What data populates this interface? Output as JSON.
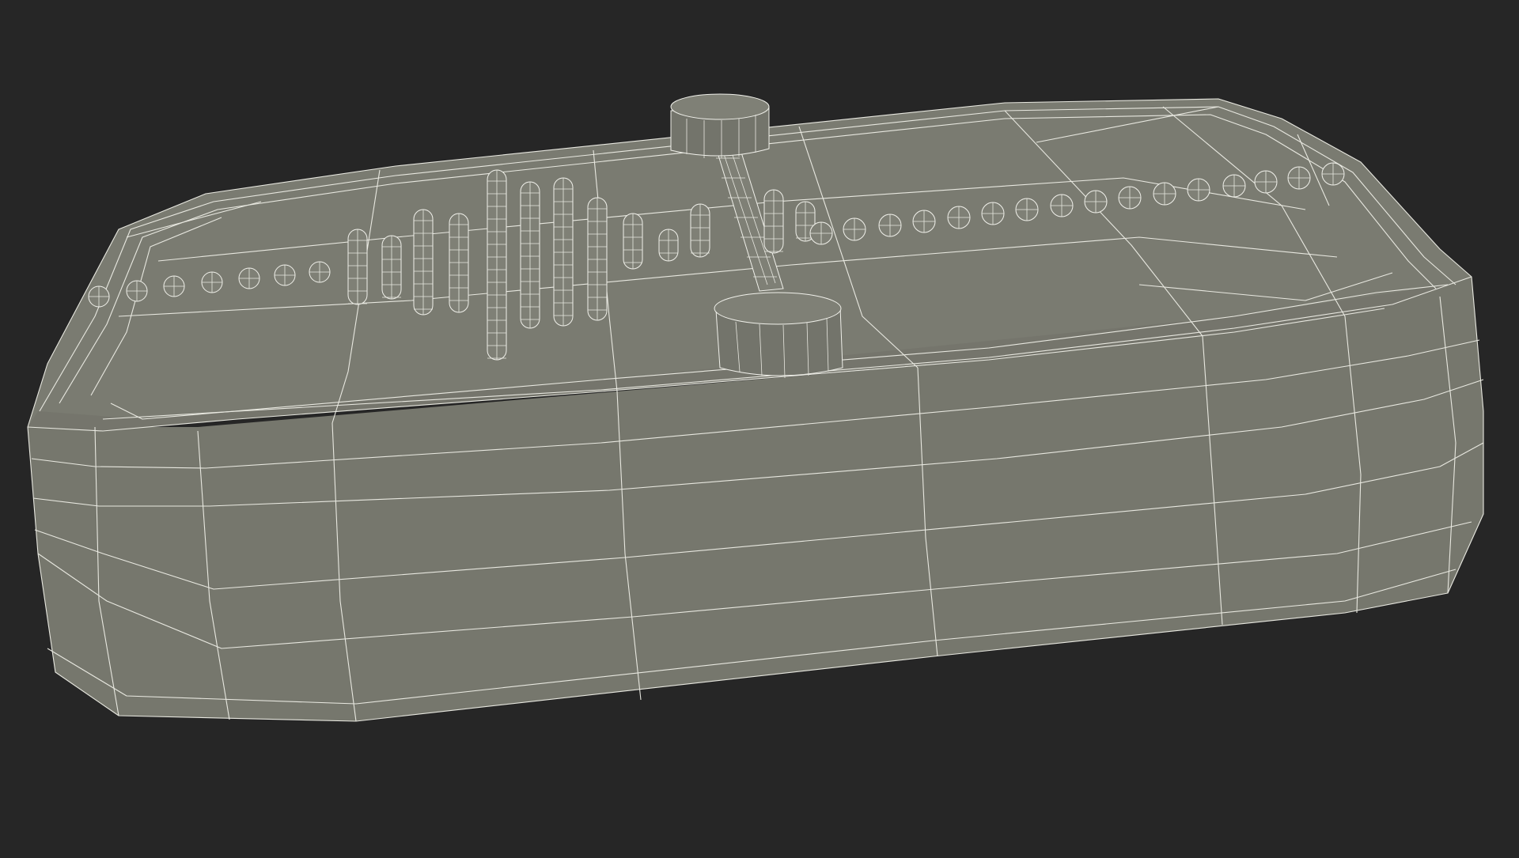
{
  "scene": {
    "background_color": "#262626",
    "mesh_color": "#7a7b71",
    "wire_color": "#e8e8e0",
    "subject": "wireframe-3d-model"
  }
}
